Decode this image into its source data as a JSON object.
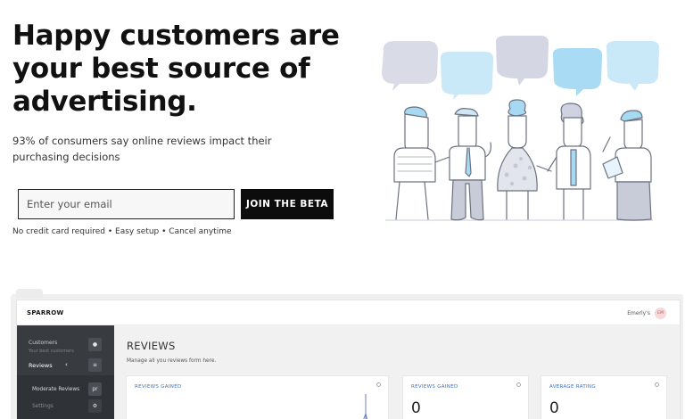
{
  "hero": {
    "title": "Happy customers are your best source of advertising.",
    "subtitle": "93% of consumers say online reviews impact their purchasing decisions"
  },
  "signup": {
    "email_placeholder": "Enter your email",
    "button_label": "JOIN THE BETA",
    "fine_print": "No credit card required • Easy setup • Cancel anytime"
  },
  "app_preview": {
    "logo": "SPARROW",
    "user_name": "Emerly's",
    "avatar_initials": "EM",
    "sidebar": {
      "customers_label": "Customers",
      "customers_sub": "Your best customers",
      "reviews_label": "Reviews",
      "reviews_chevron": "‹",
      "moderate_label": "Moderate Reviews",
      "moderate_badge": "pr",
      "settings_label": "Settings"
    },
    "page_title": "REVIEWS",
    "page_desc": "Manage all you reviews form here.",
    "cards": [
      {
        "label": "REVIEWS GAINED",
        "value": ""
      },
      {
        "label": "REVIEWS GAINED",
        "value": "0"
      },
      {
        "label": "AVERAGE RATING",
        "value": "0"
      }
    ]
  },
  "colors": {
    "bubble_grey": "#d9dbe6",
    "bubble_blue": "#bfe4f7",
    "accent_blue": "#a6d9f2",
    "button_black": "#0c0c0c"
  }
}
